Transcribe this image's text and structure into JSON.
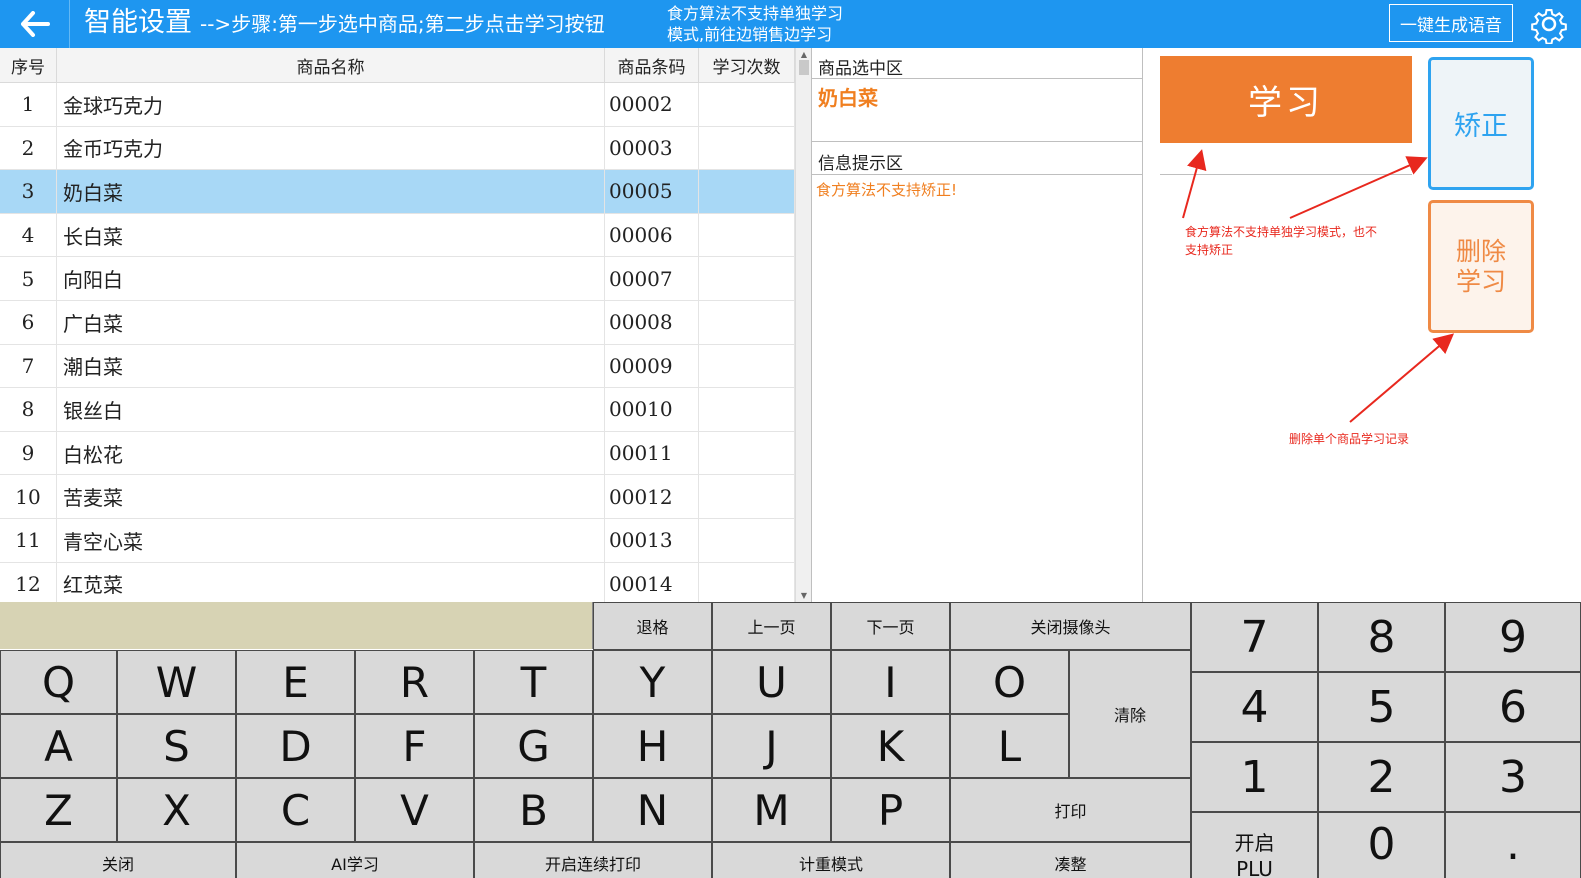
{
  "header": {
    "title": "智能设置",
    "steps": "-->步骤:第一步选中商品;第二步点击学习按钮",
    "note_line1": "食方算法不支持单独学习",
    "note_line2": "模式,前往边销售边学习",
    "voice_button": "一键生成语音",
    "back_icon": "back-arrow-icon",
    "settings_icon": "gear-icon"
  },
  "table": {
    "columns": [
      "序号",
      "商品名称",
      "商品条码",
      "学习次数"
    ],
    "rows": [
      {
        "no": "1",
        "name": "金球巧克力",
        "code": "00002",
        "count": ""
      },
      {
        "no": "2",
        "name": "金币巧克力",
        "code": "00003",
        "count": ""
      },
      {
        "no": "3",
        "name": "奶白菜",
        "code": "00005",
        "count": ""
      },
      {
        "no": "4",
        "name": "长白菜",
        "code": "00006",
        "count": ""
      },
      {
        "no": "5",
        "name": "向阳白",
        "code": "00007",
        "count": ""
      },
      {
        "no": "6",
        "name": "广白菜",
        "code": "00008",
        "count": ""
      },
      {
        "no": "7",
        "name": "潮白菜",
        "code": "00009",
        "count": ""
      },
      {
        "no": "8",
        "name": "银丝白",
        "code": "00010",
        "count": ""
      },
      {
        "no": "9",
        "name": "白松花",
        "code": "00011",
        "count": ""
      },
      {
        "no": "10",
        "name": "苦麦菜",
        "code": "00012",
        "count": ""
      },
      {
        "no": "11",
        "name": "青空心菜",
        "code": "00013",
        "count": ""
      },
      {
        "no": "12",
        "name": "红苋菜",
        "code": "00014",
        "count": ""
      }
    ],
    "selected_row": 2
  },
  "selection": {
    "label": "商品选中区",
    "value": "奶白菜"
  },
  "info": {
    "label": "信息提示区",
    "message": "食方算法不支持矫正!"
  },
  "actions": {
    "learn": "学习",
    "correct": "矫正",
    "delete_line1": "删除",
    "delete_line2": "学习"
  },
  "annotations": {
    "note1_line1": "食方算法不支持单独学习模式，也不",
    "note1_line2": "支持矫正",
    "note2": "删除单个商品学习记录",
    "color": "#e8281e"
  },
  "keyboard": {
    "function_keys": [
      "退格",
      "上一页",
      "下一页",
      "关闭摄像头"
    ],
    "row1": [
      "Q",
      "W",
      "E",
      "R",
      "T",
      "Y",
      "U",
      "I",
      "O"
    ],
    "row2": [
      "A",
      "S",
      "D",
      "F",
      "G",
      "H",
      "J",
      "K",
      "L"
    ],
    "row3": [
      "Z",
      "X",
      "C",
      "V",
      "B",
      "N",
      "M",
      "P"
    ],
    "clear": "清除",
    "print": "打印",
    "bottom_row": [
      "关闭",
      "AI学习",
      "开启连续打印",
      "计重模式",
      "凑整"
    ],
    "numpad": [
      "7",
      "8",
      "9",
      "4",
      "5",
      "6",
      "1",
      "2",
      "3"
    ],
    "plu_line1": "开启",
    "plu_line2": "PLU",
    "zero": "0",
    "dot": "."
  },
  "colors": {
    "header": "#1e96f0",
    "selected_row": "#a8d8f6",
    "learn_button": "#ee7d30",
    "correct_button": "#2ea3f0",
    "delete_button": "#ef8a45",
    "highlight_text": "#f07f20",
    "input_bar": "#d7d3b4",
    "key": "#d9d9d9"
  }
}
